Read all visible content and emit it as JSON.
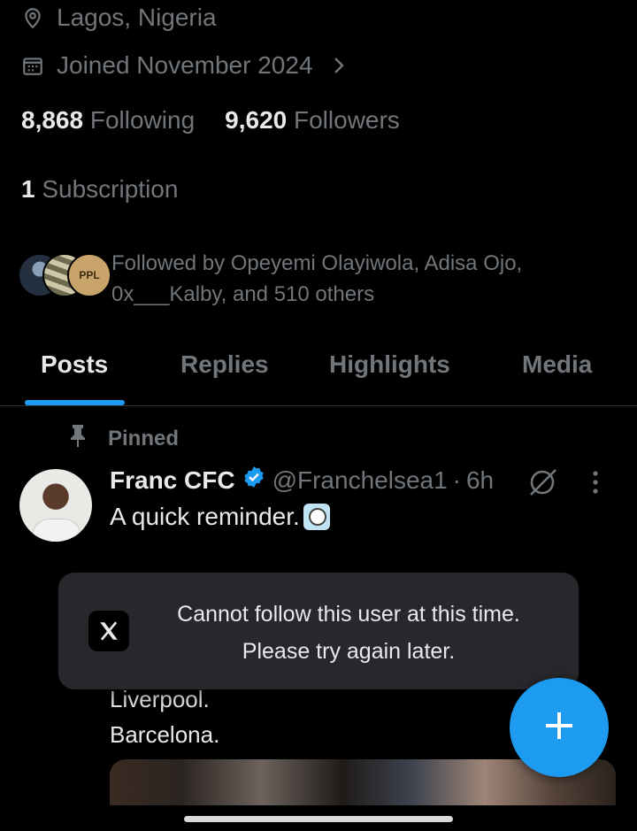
{
  "profile": {
    "location": "Lagos, Nigeria",
    "joined": "Joined November 2024",
    "following_count": "8,868",
    "following_label": "Following",
    "followers_count": "9,620",
    "followers_label": "Followers",
    "subscription_count": "1",
    "subscription_label": "Subscription",
    "followed_by_line1": "Followed by Opeyemi Olayiwola, Adisa Ojo,",
    "followed_by_line2": "0x___Kalby, and 510 others",
    "avatar3_text": "PPL"
  },
  "tabs": [
    {
      "label": "Posts",
      "active": true
    },
    {
      "label": "Replies",
      "active": false
    },
    {
      "label": "Highlights",
      "active": false
    },
    {
      "label": "Media",
      "active": false
    }
  ],
  "post": {
    "pinned_label": "Pinned",
    "author_name": "Franc CFC",
    "handle": "@Franchelsea1",
    "separator": "·",
    "time": "6h",
    "text": "A quick reminder.",
    "line1": "Liverpool.",
    "line2": "Barcelona."
  },
  "toast": {
    "line1": "Cannot follow this user at this time.",
    "line2": "Please try again later."
  },
  "colors": {
    "background": "#000000",
    "accent": "#1d9bf0",
    "muted_text": "#71767b",
    "primary_text": "#e7e9ea",
    "toast_bg": "#26282b"
  },
  "icons": [
    "location-icon",
    "calendar-icon",
    "chevron-right-icon",
    "pin-icon",
    "verified-badge-icon",
    "grok-icon",
    "more-vertical-icon",
    "x-logo-icon",
    "plus-icon"
  ]
}
